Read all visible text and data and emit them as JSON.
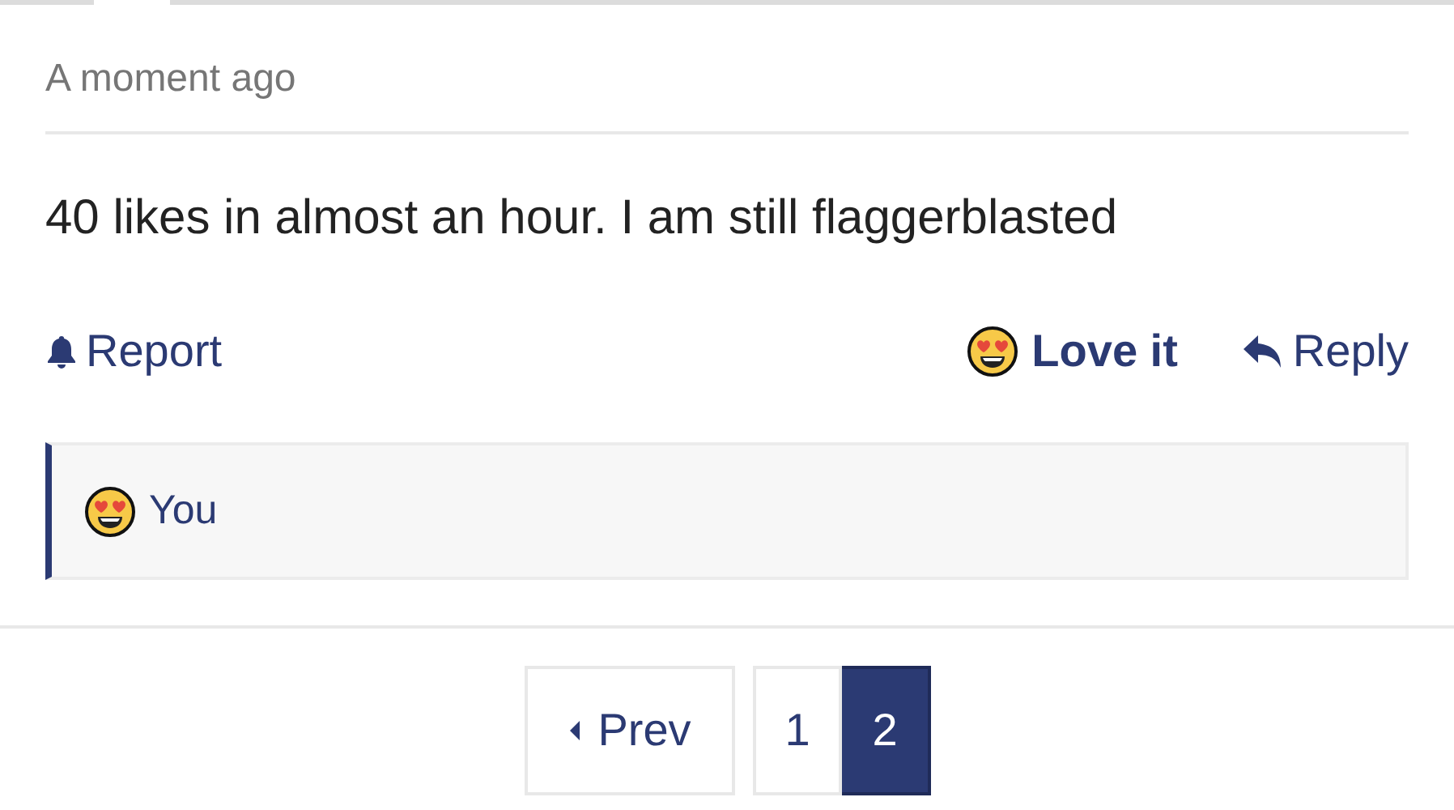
{
  "post": {
    "timestamp": "A moment ago",
    "text": "40 likes in almost an hour. I am still flaggerblasted"
  },
  "actions": {
    "report": "Report",
    "love": "Love it",
    "reply": "Reply"
  },
  "reactions": [
    {
      "name": "You"
    }
  ],
  "pagination": {
    "prev": "Prev",
    "pages": [
      {
        "label": "1",
        "selected": false
      },
      {
        "label": "2",
        "selected": true
      }
    ]
  }
}
